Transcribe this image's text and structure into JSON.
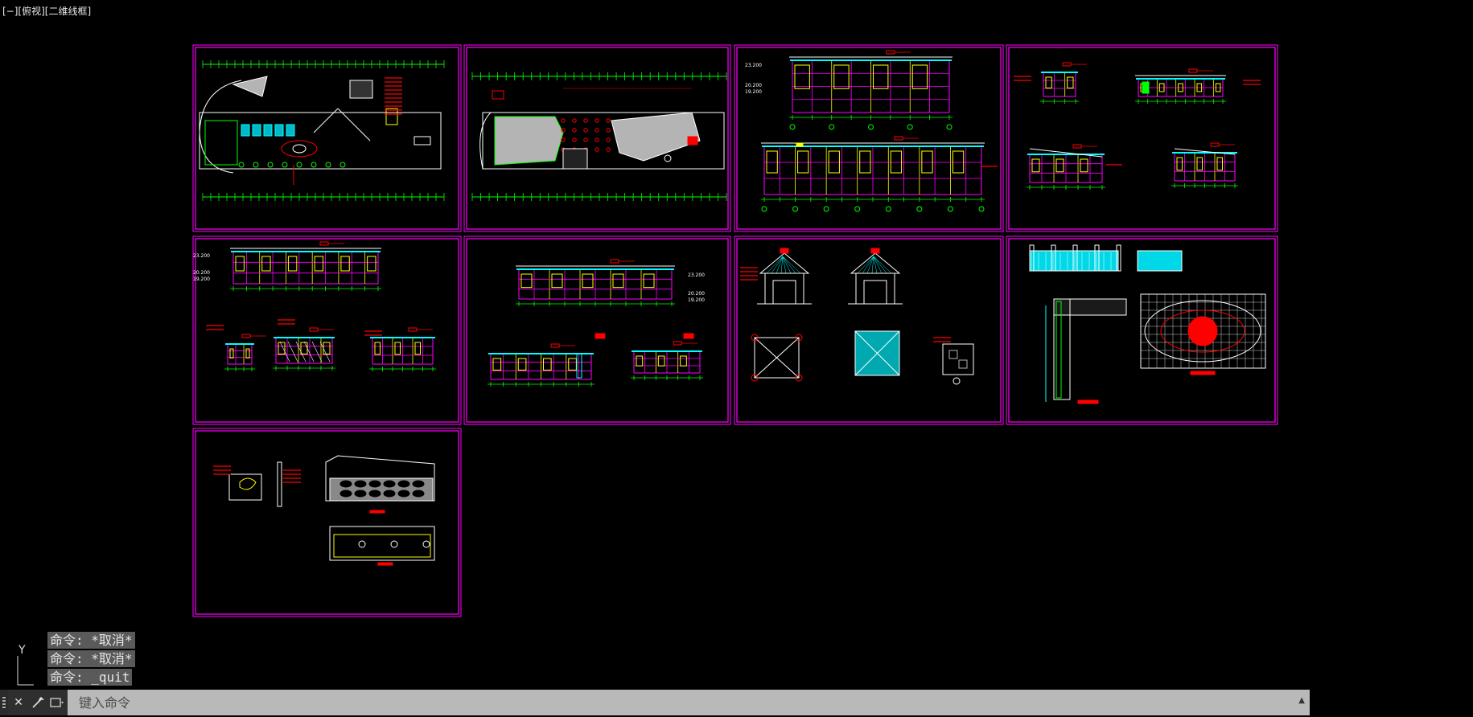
{
  "viewport": {
    "label": "[−][俯视][二维线框]"
  },
  "colors": {
    "background": "#000000",
    "sheet_border": "#ff00ff",
    "green": "#00ff00",
    "red": "#ff0000",
    "yellow": "#ffff00",
    "cyan": "#00ffff",
    "magenta": "#ff00ff",
    "white": "#ffffff",
    "gray": "#b4b4b4",
    "command_bar": "#b9b9b9"
  },
  "sheets": [
    {
      "id": "sheet-1",
      "content": "floor-plan-furniture"
    },
    {
      "id": "sheet-2",
      "content": "floor-plan-ceiling"
    },
    {
      "id": "sheet-3",
      "content": "elevations-a"
    },
    {
      "id": "sheet-4",
      "content": "sections-a"
    },
    {
      "id": "sheet-5",
      "content": "elevations-b"
    },
    {
      "id": "sheet-6",
      "content": "elevations-c"
    },
    {
      "id": "sheet-7",
      "content": "pavilion-details"
    },
    {
      "id": "sheet-8",
      "content": "paving-and-wall-details"
    },
    {
      "id": "sheet-9",
      "content": "feature-wall-details"
    }
  ],
  "dimension_labels": [
    "23.200",
    "20.200",
    "19.200"
  ],
  "command_history": [
    "命令: *取消*",
    "命令: *取消*",
    "命令: _quit"
  ],
  "command_bar": {
    "placeholder": "键入命令",
    "close_icon": "close-icon",
    "wrench_icon": "wrench-icon",
    "history_icon": "recent-commands-icon"
  },
  "ucs": {
    "y_label": "Y",
    "icon": "ucs-icon"
  }
}
